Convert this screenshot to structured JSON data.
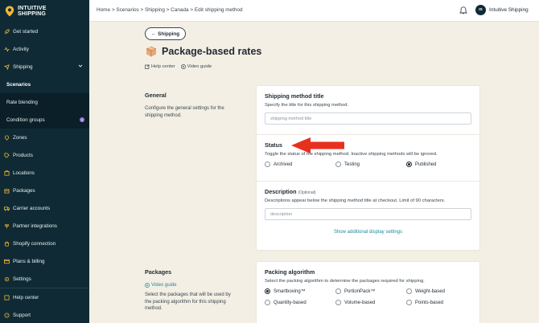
{
  "sidebar": {
    "logo": {
      "line1": "INTUITIVE",
      "line2": "SHIPPING"
    },
    "items": [
      {
        "label": "Get started",
        "icon": "rocket-icon"
      },
      {
        "label": "Activity",
        "icon": "activity-icon"
      },
      {
        "label": "Shipping",
        "icon": "shipping-icon"
      },
      {
        "label": "Zones",
        "icon": "pin-icon"
      },
      {
        "label": "Products",
        "icon": "tag-icon"
      },
      {
        "label": "Locations",
        "icon": "location-icon"
      },
      {
        "label": "Packages",
        "icon": "package-icon"
      },
      {
        "label": "Carrier accounts",
        "icon": "truck-icon"
      },
      {
        "label": "Partner integrations",
        "icon": "plug-icon"
      },
      {
        "label": "Shopify connection",
        "icon": "shopify-icon"
      },
      {
        "label": "Plans & billing",
        "icon": "card-icon"
      },
      {
        "label": "Settings",
        "icon": "gear-icon"
      }
    ],
    "subitems": [
      {
        "label": "Scenarios"
      },
      {
        "label": "Rate blending"
      },
      {
        "label": "Condition groups",
        "badge": "!"
      }
    ],
    "bottom": [
      {
        "label": "Help center",
        "icon": "help-icon"
      },
      {
        "label": "Support",
        "icon": "support-icon"
      }
    ]
  },
  "topbar": {
    "breadcrumb": "Home > Scenarios > Shipping > Canada > Edit shipping method",
    "avatar_initials": "IS",
    "account_name": "Intuitive Shipping"
  },
  "header": {
    "back_label": "Shipping",
    "title": "Package-based rates",
    "help_link": "Help center",
    "video_link": "Video guide"
  },
  "general": {
    "label": "General",
    "description": "Configure the general settings for the shipping method.",
    "method_title": {
      "label": "Shipping method title",
      "help": "Specify the title for this shipping method.",
      "placeholder": "shipping method title"
    },
    "status": {
      "label": "Status",
      "help": "Toggle the status of the shipping method. Inactive shipping methods will be ignored.",
      "options": [
        "Archived",
        "Testing",
        "Published"
      ],
      "selected": "Published"
    },
    "description_field": {
      "label": "Description",
      "optional": "(Optional)",
      "help": "Descriptions appear below the shipping method title at checkout. Limit of 90 characters.",
      "placeholder": "description"
    },
    "more_link": "Show additional display settings"
  },
  "packages": {
    "label": "Packages",
    "video_link": "Video guide",
    "description": "Select the packages that will be used by the packing algorithm for this shipping method.",
    "algorithm": {
      "label": "Packing algorithm",
      "help": "Select the packing algorithm to determine the packages required for shipping.",
      "options": [
        "Smartboxing™",
        "PortionPack™",
        "Weight-based",
        "Quantity-based",
        "Volume-based",
        "Points-based"
      ],
      "selected": "Smartboxing™"
    }
  },
  "colors": {
    "sidebar": "#0f2a34",
    "background": "#f3efe4",
    "accent": "#1f8a9b",
    "arrow": "#e8301f"
  }
}
